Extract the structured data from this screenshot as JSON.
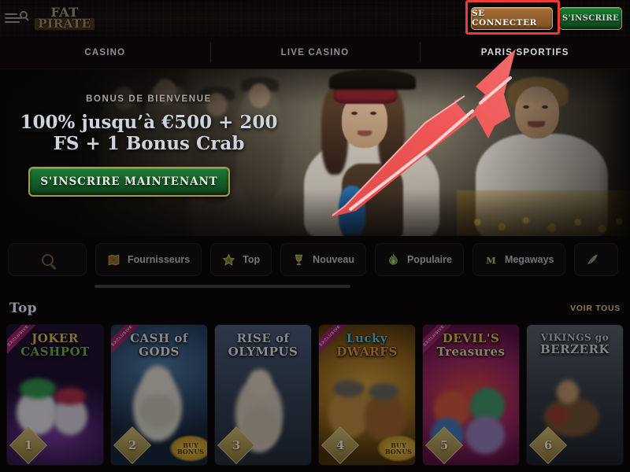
{
  "header": {
    "menu_icon": "menu-search-icon",
    "logo_line1": "FAT",
    "logo_line2": "PIRATE",
    "login_label": "SE CONNECTER",
    "signup_label": "S'INSCRIRE"
  },
  "nav": {
    "tabs": [
      {
        "label": "CASINO",
        "active": false
      },
      {
        "label": "LIVE CASINO",
        "active": false
      },
      {
        "label": "PARIS SPORTIFS",
        "active": true
      }
    ]
  },
  "hero": {
    "kicker": "BONUS DE BIENVENUE",
    "title_line1": "100% jusqu’à €500 + 200",
    "title_line2": "FS + 1 Bonus Crab",
    "cta_label": "S'INSCRIRE MAINTENANT"
  },
  "chips": {
    "search_icon": "search-icon",
    "items": [
      {
        "label": "Fournisseurs",
        "icon": "treasure-map-icon"
      },
      {
        "label": "Top",
        "icon": "star-icon"
      },
      {
        "label": "Nouveau",
        "icon": "goblet-icon"
      },
      {
        "label": "Populaire",
        "icon": "flame-icon"
      },
      {
        "label": "Megaways",
        "icon": "letter-m-icon"
      },
      {
        "label": "",
        "icon": "parrot-feather-icon"
      }
    ]
  },
  "section": {
    "title": "Top",
    "see_all_label": "VOIR TOUS"
  },
  "games": [
    {
      "rank": "1",
      "title_line1": "JOKER",
      "title_line2": "CASHPOT",
      "exclusive": true,
      "exclusive_label": "EXCLUSIVE",
      "buy_bonus": false,
      "art": "art-joker"
    },
    {
      "rank": "2",
      "title_line1": "CASH of",
      "title_line2": "GODS",
      "exclusive": true,
      "exclusive_label": "EXCLUSIVE",
      "buy_bonus": true,
      "buy_bonus_label": "BUY BONUS",
      "art": "art-cash"
    },
    {
      "rank": "3",
      "title_line1": "RISE of",
      "title_line2": "OLYMPUS",
      "exclusive": false,
      "exclusive_label": "",
      "buy_bonus": false,
      "art": "art-olympus"
    },
    {
      "rank": "4",
      "title_line1": "Lucky",
      "title_line2": "DWARFS",
      "exclusive": true,
      "exclusive_label": "EXCLUSIVE",
      "buy_bonus": true,
      "buy_bonus_label": "BUY BONUS",
      "art": "art-dwarfs"
    },
    {
      "rank": "5",
      "title_line1": "DEVIL'S",
      "title_line2": "Treasures",
      "exclusive": true,
      "exclusive_label": "EXCLUSIVE",
      "buy_bonus": false,
      "art": "art-devils"
    },
    {
      "rank": "6",
      "title_line1": "VIKINGS go",
      "title_line2": "BERZERK",
      "exclusive": false,
      "exclusive_label": "",
      "buy_bonus": false,
      "art": "art-vikings"
    }
  ],
  "annotation": {
    "type": "pointer-arrow",
    "color": "#ef4444",
    "points_to": "SE CONNECTER",
    "highlight_box_color": "#ef3a38"
  }
}
